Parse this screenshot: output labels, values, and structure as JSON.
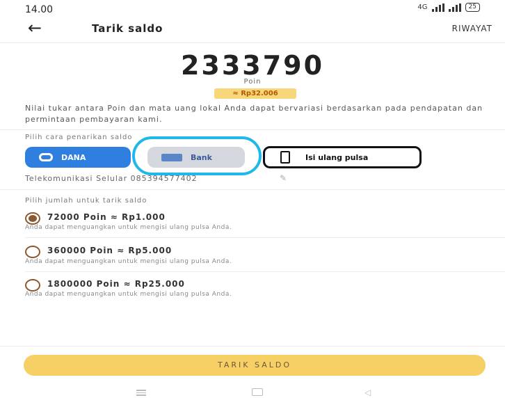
{
  "status": {
    "time": "14.00",
    "network": "4G",
    "battery": "25"
  },
  "header": {
    "title": "Tarik saldo",
    "history_label": "RIWAYAT"
  },
  "balance": {
    "points": "2333790",
    "unit": "Poin",
    "rupiah": "≈ Rp32.006",
    "info": "Nilai tukar antara Poin dan mata uang lokal Anda dapat bervariasi berdasarkan pada pendapatan dan permintaan pembayaran kami."
  },
  "methods": {
    "label": "Pilih cara penarikan saldo",
    "items": [
      {
        "label": "DANA",
        "icon": "dana-icon"
      },
      {
        "label": "Bank",
        "icon": "bank-card-icon"
      },
      {
        "label": "Isi ulang pulsa",
        "icon": "phone-icon"
      }
    ],
    "selected_number": "Telekomunikasi Selular 085394577402"
  },
  "amounts": {
    "label": "Pilih jumlah untuk tarik saldo",
    "options": [
      {
        "label": "72000 Poin ≈ Rp1.000",
        "desc": "Anda dapat menguangkan untuk mengisi ulang pulsa Anda.",
        "selected": true
      },
      {
        "label": "360000 Poin ≈ Rp5.000",
        "desc": "Anda dapat menguangkan untuk mengisi ulang pulsa Anda.",
        "selected": false
      },
      {
        "label": "1800000 Poin ≈ Rp25.000",
        "desc": "Anda dapat menguangkan untuk mengisi ulang pulsa Anda.",
        "selected": false
      }
    ]
  },
  "submit_label": "TARIK SALDO",
  "colors": {
    "accent": "#f6cf65",
    "dana": "#2f7fe0",
    "highlight_ring": "#1fb8ea",
    "radio": "#8a5a2e"
  }
}
